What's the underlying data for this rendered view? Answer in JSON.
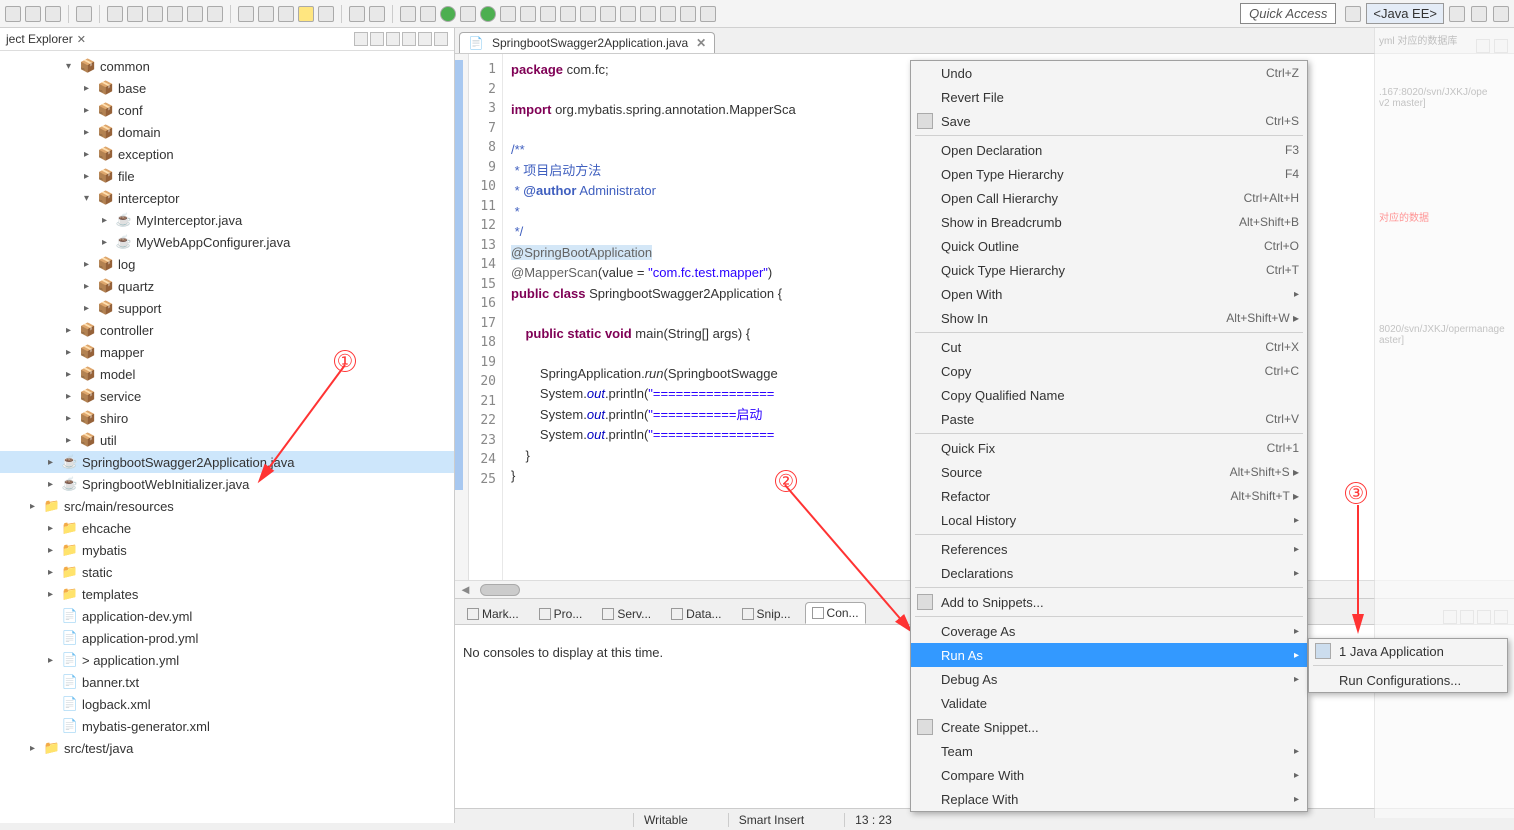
{
  "toolbar": {
    "quick_access": "Quick Access",
    "perspective": "<Java EE>"
  },
  "explorer": {
    "title": "ject Explorer",
    "close": "✕",
    "tree": [
      {
        "indent": 1,
        "twist": "v",
        "icon": "pkg",
        "label": "common"
      },
      {
        "indent": 2,
        "twist": ">",
        "icon": "pkg",
        "label": "base"
      },
      {
        "indent": 2,
        "twist": ">",
        "icon": "pkg",
        "label": "conf"
      },
      {
        "indent": 2,
        "twist": ">",
        "icon": "pkg",
        "label": "domain"
      },
      {
        "indent": 2,
        "twist": ">",
        "icon": "pkg",
        "label": "exception"
      },
      {
        "indent": 2,
        "twist": ">",
        "icon": "pkg",
        "label": "file"
      },
      {
        "indent": 2,
        "twist": "v",
        "icon": "pkg",
        "label": "interceptor"
      },
      {
        "indent": 3,
        "twist": ">",
        "icon": "jav",
        "label": "MyInterceptor.java"
      },
      {
        "indent": 3,
        "twist": ">",
        "icon": "jav",
        "label": "MyWebAppConfigurer.java"
      },
      {
        "indent": 2,
        "twist": ">",
        "icon": "pkg",
        "label": "log"
      },
      {
        "indent": 2,
        "twist": ">",
        "icon": "pkg",
        "label": "quartz"
      },
      {
        "indent": 2,
        "twist": ">",
        "icon": "pkg",
        "label": "support"
      },
      {
        "indent": 1,
        "twist": ">",
        "icon": "pkg",
        "label": "controller"
      },
      {
        "indent": 1,
        "twist": ">",
        "icon": "pkg",
        "label": "mapper"
      },
      {
        "indent": 1,
        "twist": ">",
        "icon": "pkg",
        "label": "model"
      },
      {
        "indent": 1,
        "twist": ">",
        "icon": "pkg",
        "label": "service"
      },
      {
        "indent": 1,
        "twist": ">",
        "icon": "pkg",
        "label": "shiro"
      },
      {
        "indent": 1,
        "twist": ">",
        "icon": "pkg",
        "label": "util"
      },
      {
        "indent": 0,
        "twist": ">",
        "icon": "jav",
        "label": "SpringbootSwagger2Application.java",
        "selected": true
      },
      {
        "indent": 0,
        "twist": ">",
        "icon": "jav",
        "label": "SpringbootWebInitializer.java"
      },
      {
        "indent": -1,
        "twist": ">",
        "icon": "fld",
        "label": "src/main/resources"
      },
      {
        "indent": 0,
        "twist": ">",
        "icon": "fld",
        "label": "ehcache"
      },
      {
        "indent": 0,
        "twist": ">",
        "icon": "fld",
        "label": "mybatis"
      },
      {
        "indent": 0,
        "twist": ">",
        "icon": "fld",
        "label": "static"
      },
      {
        "indent": 0,
        "twist": ">",
        "icon": "fld",
        "label": "templates"
      },
      {
        "indent": 0,
        "twist": "",
        "icon": "fil",
        "label": "application-dev.yml"
      },
      {
        "indent": 0,
        "twist": "",
        "icon": "fil",
        "label": "application-prod.yml"
      },
      {
        "indent": 0,
        "twist": ">",
        "icon": "fil",
        "label": "> application.yml"
      },
      {
        "indent": 0,
        "twist": "",
        "icon": "fil",
        "label": "banner.txt"
      },
      {
        "indent": 0,
        "twist": "",
        "icon": "fil",
        "label": "logback.xml"
      },
      {
        "indent": 0,
        "twist": "",
        "icon": "fil",
        "label": "mybatis-generator.xml"
      },
      {
        "indent": -1,
        "twist": ">",
        "icon": "fld",
        "label": "src/test/java"
      }
    ]
  },
  "editor": {
    "tab": "SpringbootSwagger2Application.java",
    "line_numbers": "1\n2\n3\n7\n8\n9\n10\n11\n12\n13\n14\n15\n16\n17\n18\n19\n20\n21\n22\n23\n24\n25",
    "lines": {
      "l1_kw": "package",
      "l1_txt": " com.fc;",
      "l3_kw": "import",
      "l3_txt": " org.mybatis.spring.annotation.MapperSca",
      "l8": "/**",
      "l9": " * 项目启动方法",
      "l10a": " * ",
      "l10b": "@author",
      "l10c": " Administrator",
      "l11": " *",
      "l12": " */",
      "l13": "@SpringBootApplication",
      "l14a": "@MapperScan",
      "l14b": "(value = ",
      "l14c": "\"com.fc.test.mapper\"",
      "l14d": ")",
      "l15a": "public",
      "l15b": " ",
      "l15c": "class",
      "l15d": " SpringbootSwagger2Application {",
      "l17a": "    public",
      "l17b": " ",
      "l17c": "static",
      "l17d": " ",
      "l17e": "void",
      "l17f": " main(String[] args) {",
      "l19a": "        SpringApplication.",
      "l19b": "run",
      "l19c": "(SpringbootSwagge",
      "l20a": "        System.",
      "l20b": "out",
      "l20c": ".println(",
      "l20d": "\"================",
      "l21a": "        System.",
      "l21b": "out",
      "l21c": ".println(",
      "l21d": "\"===========启动",
      "l22a": "        System.",
      "l22b": "out",
      "l22c": ".println(",
      "l22d": "\"================",
      "l23": "    }",
      "l24": "}"
    }
  },
  "bottom": {
    "tabs": [
      "Mark...",
      "Pro...",
      "Serv...",
      "Data...",
      "Snip...",
      "Con..."
    ],
    "active_idx": 5,
    "message": "No consoles to display at this time."
  },
  "context_menu": [
    {
      "label": "Undo",
      "shortcut": "Ctrl+Z"
    },
    {
      "label": "Revert File"
    },
    {
      "label": "Save",
      "shortcut": "Ctrl+S",
      "icon": true
    },
    {
      "sep": true
    },
    {
      "label": "Open Declaration",
      "shortcut": "F3"
    },
    {
      "label": "Open Type Hierarchy",
      "shortcut": "F4"
    },
    {
      "label": "Open Call Hierarchy",
      "shortcut": "Ctrl+Alt+H"
    },
    {
      "label": "Show in Breadcrumb",
      "shortcut": "Alt+Shift+B"
    },
    {
      "label": "Quick Outline",
      "shortcut": "Ctrl+O"
    },
    {
      "label": "Quick Type Hierarchy",
      "shortcut": "Ctrl+T"
    },
    {
      "label": "Open With",
      "sub": true
    },
    {
      "label": "Show In",
      "shortcut": "Alt+Shift+W",
      "sub": true
    },
    {
      "sep": true
    },
    {
      "label": "Cut",
      "shortcut": "Ctrl+X"
    },
    {
      "label": "Copy",
      "shortcut": "Ctrl+C"
    },
    {
      "label": "Copy Qualified Name"
    },
    {
      "label": "Paste",
      "shortcut": "Ctrl+V"
    },
    {
      "sep": true
    },
    {
      "label": "Quick Fix",
      "shortcut": "Ctrl+1"
    },
    {
      "label": "Source",
      "shortcut": "Alt+Shift+S",
      "sub": true
    },
    {
      "label": "Refactor",
      "shortcut": "Alt+Shift+T",
      "sub": true
    },
    {
      "label": "Local History",
      "sub": true
    },
    {
      "sep": true
    },
    {
      "label": "References",
      "sub": true
    },
    {
      "label": "Declarations",
      "sub": true
    },
    {
      "sep": true
    },
    {
      "label": "Add to Snippets...",
      "icon": true
    },
    {
      "sep": true
    },
    {
      "label": "Coverage As",
      "sub": true
    },
    {
      "label": "Run As",
      "sub": true,
      "highlighted": true
    },
    {
      "label": "Debug As",
      "sub": true
    },
    {
      "label": "Validate"
    },
    {
      "label": "Create Snippet...",
      "icon": true
    },
    {
      "label": "Team",
      "sub": true
    },
    {
      "label": "Compare With",
      "sub": true
    },
    {
      "label": "Replace With",
      "sub": true
    }
  ],
  "submenu": [
    {
      "label": "1 Java Application",
      "icon": true
    },
    {
      "sep": true
    },
    {
      "label": "Run Configurations..."
    }
  ],
  "status": {
    "writable": "Writable",
    "insert": "Smart Insert",
    "pos": "13 : 23"
  },
  "annotations": {
    "n1": "①",
    "n2": "②",
    "n3": "③"
  },
  "right_panel": {
    "l1": "yml  对应的数据库",
    "l2": ".167:8020/svn/JXKJ/ope",
    "l3": "v2 master]",
    "l4": "对应的数据",
    "l5": "8020/svn/JXKJ/opermanage",
    "l6": "aster]"
  }
}
